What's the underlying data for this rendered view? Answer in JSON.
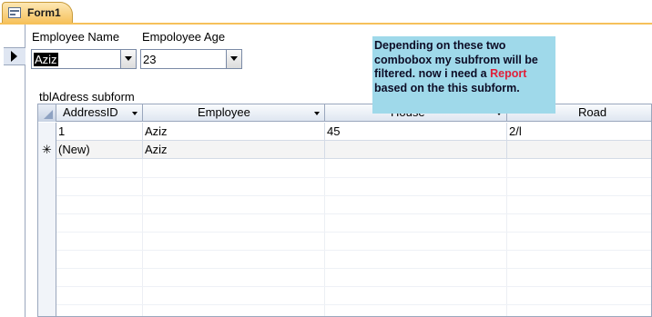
{
  "tab": {
    "label": "Form1",
    "icon": "form-icon"
  },
  "form": {
    "employee_name_label": "Employee Name",
    "employee_age_label": "Empoloyee Age",
    "employee_name_value": "Aziz",
    "employee_age_value": "23",
    "subform_label": "tblAdress subform"
  },
  "note": {
    "line1": "Depending on these two",
    "line2": "combobox my subfrom will be",
    "line3a": "filtered. now i need a ",
    "line3b": "Report",
    "line4": "based on the this subform."
  },
  "grid": {
    "columns": [
      {
        "label": "AddressID"
      },
      {
        "label": "Employee"
      },
      {
        "label": "House"
      },
      {
        "label": "Road"
      }
    ],
    "rows": [
      {
        "selector": "",
        "address_id": "1",
        "employee": "Aziz",
        "house": "45",
        "road": "2/l"
      },
      {
        "selector": "✳",
        "address_id": "(New)",
        "employee": "Aziz",
        "house": "",
        "road": ""
      }
    ]
  },
  "colors": {
    "tab": "#f6c15a",
    "note_bg": "#9fd9ea",
    "note_highlight": "#e0203a"
  }
}
